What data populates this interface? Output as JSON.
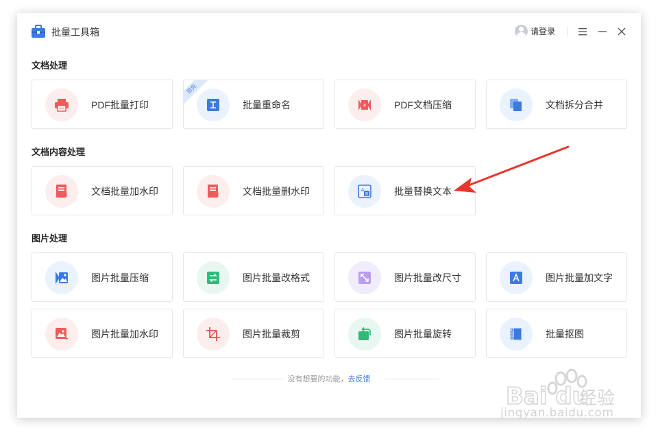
{
  "app": {
    "title": "批量工具箱",
    "login_text": "请登录"
  },
  "sections": {
    "doc": "文档处理",
    "content": "文档内容处理",
    "image": "图片处理"
  },
  "cards": {
    "pdf_print": "PDF批量打印",
    "rename": "批量重命名",
    "rename_badge": "限免",
    "pdf_compress": "PDF文档压缩",
    "split_merge": "文档拆分合并",
    "add_watermark": "文档批量加水印",
    "remove_watermark": "文档批量删水印",
    "replace_text": "批量替换文本",
    "img_compress": "图片批量压缩",
    "img_format": "图片批量改格式",
    "img_resize": "图片批量改尺寸",
    "img_text": "图片批量加文字",
    "img_watermark": "图片批量加水印",
    "img_crop": "图片批量裁剪",
    "img_rotate": "图片批量旋转",
    "matting": "批量抠图"
  },
  "footer": {
    "text": "没有想要的功能，",
    "link": "去反馈"
  },
  "watermark": {
    "brand": "Baidu经验",
    "url": "jingyan.baidu.com"
  },
  "colors": {
    "accent": "#3b7ae0",
    "red": "#ef5a5a",
    "green": "#2dbb79",
    "purple": "#9a7ae8",
    "arrow": "#e8362d"
  }
}
